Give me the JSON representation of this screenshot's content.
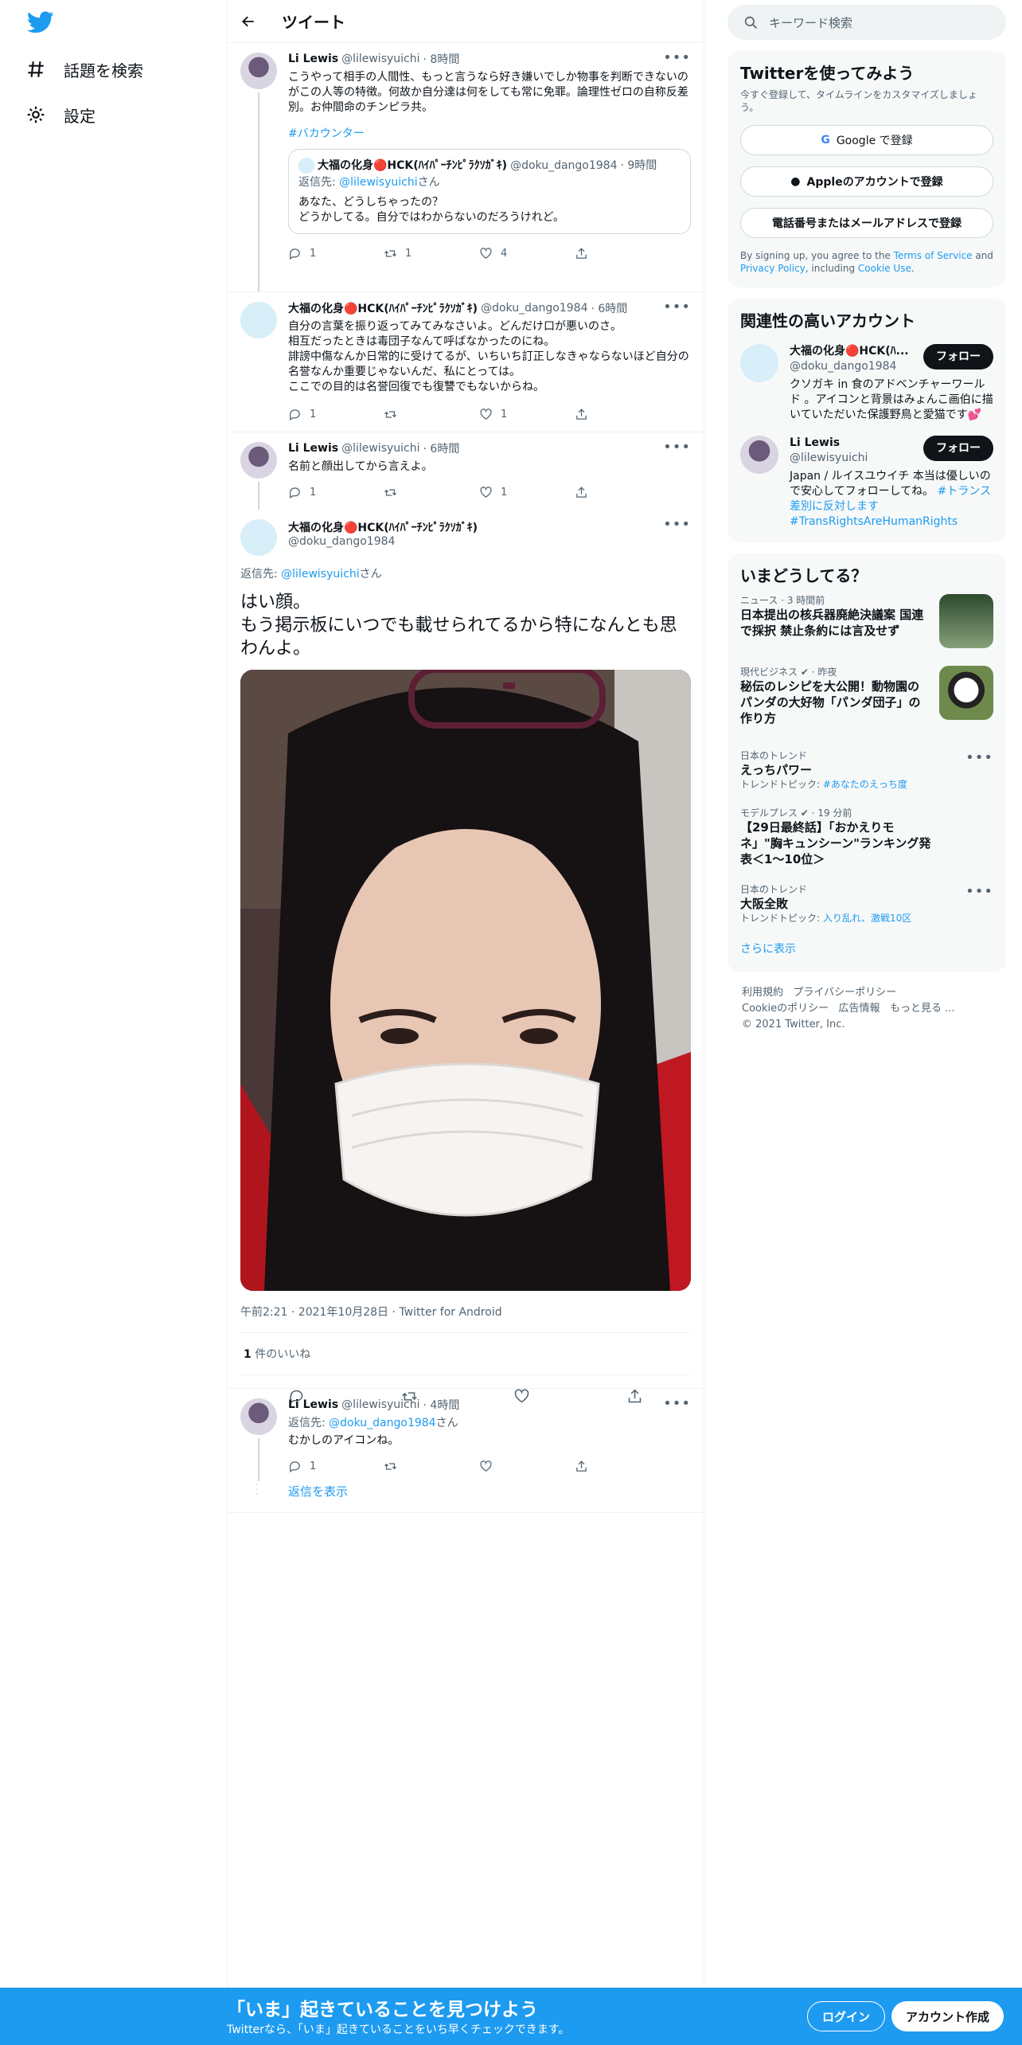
{
  "nav": {
    "explore_label": "話題を検索",
    "settings_label": "設定"
  },
  "header": {
    "title": "ツイート"
  },
  "tweet1": {
    "name": "Li Lewis",
    "handle": "@lilewisyuichi",
    "time": "· 8時間",
    "text": "こうやって相手の人間性、もっと言うなら好き嫌いでしか物事を判断できないのがこの人等の特徴。何故か自分達は何をしても常に免罪。論理性ゼロの自称反差別。お仲間命のチンピラ共。",
    "hashtag": "#バカウンター",
    "quote": {
      "name": "大福の化身🔴HCK(ﾊｲﾊﾟｰﾁﾝﾋﾟﾗｸｿｶﾞｷ)",
      "handle": "@doku_dango1984",
      "time": "· 9時間",
      "reply_prefix": "返信先: ",
      "reply_to": "@lilewisyuichi",
      "reply_suffix": "さん",
      "text": "あなた、どうしちゃったの？\nどうかしてる。自分ではわからないのだろうけれど。"
    },
    "counts": {
      "reply": "1",
      "retweet": "1",
      "like": "4"
    }
  },
  "tweet2": {
    "name": "大福の化身🔴HCK(ﾊｲﾊﾟｰﾁﾝﾋﾟﾗｸｿｶﾞｷ)",
    "handle": "@doku_dango1984",
    "time": "· 6時間",
    "text": "自分の言葉を振り返ってみてみなさいよ。どんだけ口が悪いのさ。\n相互だったときは毒団子なんて呼ばなかったのにね。\n誹謗中傷なんか日常的に受けてるが、いちいち訂正しなきゃならないほど自分の名誉なんか重要じゃないんだ、私にとっては。\nここでの目的は名誉回復でも復讐でもないからね。",
    "counts": {
      "reply": "1",
      "retweet": "",
      "like": "1"
    }
  },
  "tweet3": {
    "name": "Li Lewis",
    "handle": "@lilewisyuichi",
    "time": "· 6時間",
    "text": "名前と顔出してから言えよ。",
    "counts": {
      "reply": "1",
      "retweet": "",
      "like": "1"
    }
  },
  "focus": {
    "name": "大福の化身🔴HCK(ﾊｲﾊﾟｰﾁﾝﾋﾟﾗｸｿｶﾞｷ)",
    "handle": "@doku_dango1984",
    "reply_prefix": "返信先: ",
    "reply_to": "@lilewisyuichi",
    "reply_suffix": "さん",
    "text": "はい顔。\nもう掲示板にいつでも載せられてるから特になんとも思わんよ。",
    "meta": "午前2:21 · 2021年10月28日 · Twitter for Android",
    "likes_count": "1",
    "likes_label": " 件のいいね"
  },
  "tweet5": {
    "name": "Li Lewis",
    "handle": "@lilewisyuichi",
    "time": "· 4時間",
    "reply_prefix": "返信先: ",
    "reply_to": "@doku_dango1984",
    "reply_suffix": "さん",
    "text": "むかしのアイコンね。",
    "counts": {
      "reply": "1",
      "retweet": "",
      "like": ""
    },
    "show_replies": "返信を表示"
  },
  "right": {
    "search_placeholder": "キーワード検索",
    "signup": {
      "title": "Twitterを使ってみよう",
      "subtitle": "今すぐ登録して、タイムラインをカスタマイズしましょう。",
      "google": "Google で登録",
      "apple": "Appleのアカウントで登録",
      "phone": "電話番号またはメールアドレスで登録",
      "terms_prefix": "By signing up, you agree to the ",
      "terms": "Terms of Service",
      "and": " and ",
      "privacy": "Privacy Policy",
      "including": ", including ",
      "cookie": "Cookie Use",
      "period": "."
    },
    "related": {
      "title": "関連性の高いアカウント",
      "accounts": [
        {
          "name": "大福の化身🔴HCK(ﾊ...",
          "handle": "@doku_dango1984",
          "follow": "フォロー",
          "bio": "クソガキ in 食のアドベンチャーワールド 。アイコンと背景はみょんこ画伯に描いていただいた保護野鳥と愛猫です💕",
          "bio_link": ""
        },
        {
          "name": "Li Lewis",
          "handle": "@lilewisyuichi",
          "follow": "フォロー",
          "bio": "Japan / ルイスユウイチ 本当は優しいので安心してフォローしてね。",
          "bio_link": "#トランス差別に反対します #TransRightsAreHumanRights"
        }
      ]
    },
    "trends": {
      "title": "いまどうしてる？",
      "items": [
        {
          "context": "ニュース · 3 時間前",
          "title": "日本提出の核兵器廃絶決議案 国連で採択 禁止条約には言及せず",
          "sub": ""
        },
        {
          "context": "現代ビジネス ✔ · 昨夜",
          "title": "秘伝のレシピを大公開！動物園のパンダの大好物「パンダ団子」の作り方",
          "sub": ""
        },
        {
          "context": "日本のトレンド",
          "title": "えっちパワー",
          "sub_prefix": "トレンドトピック: ",
          "sub": "#あなたのえっち度"
        },
        {
          "context": "モデルプレス ✔ · 19 分前",
          "title": "【29日最終話】「おかえりモネ」\"胸キュンシーン\"ランキング発表＜1～10位＞",
          "sub": ""
        },
        {
          "context": "日本のトレンド",
          "title": "大阪全敗",
          "sub_prefix": "トレンドトピック: ",
          "sub": "入り乱れ、激戦10区"
        }
      ],
      "more": "さらに表示"
    },
    "footer": {
      "l1": "利用規約",
      "l2": "プライバシーポリシー",
      "l3": "Cookieのポリシー",
      "l4": "広告情報",
      "l5": "もっと見る ...",
      "copy": "© 2021 Twitter, Inc."
    }
  },
  "bottombar": {
    "headline": "「いま」起きていることを見つけよう",
    "sub": "Twitterなら、「いま」起きていることをいち早くチェックできます。",
    "login": "ログイン",
    "signup": "アカウント作成"
  },
  "colors": {
    "accent": "#1d9bf0",
    "text": "#0f1419",
    "muted": "#536471"
  }
}
